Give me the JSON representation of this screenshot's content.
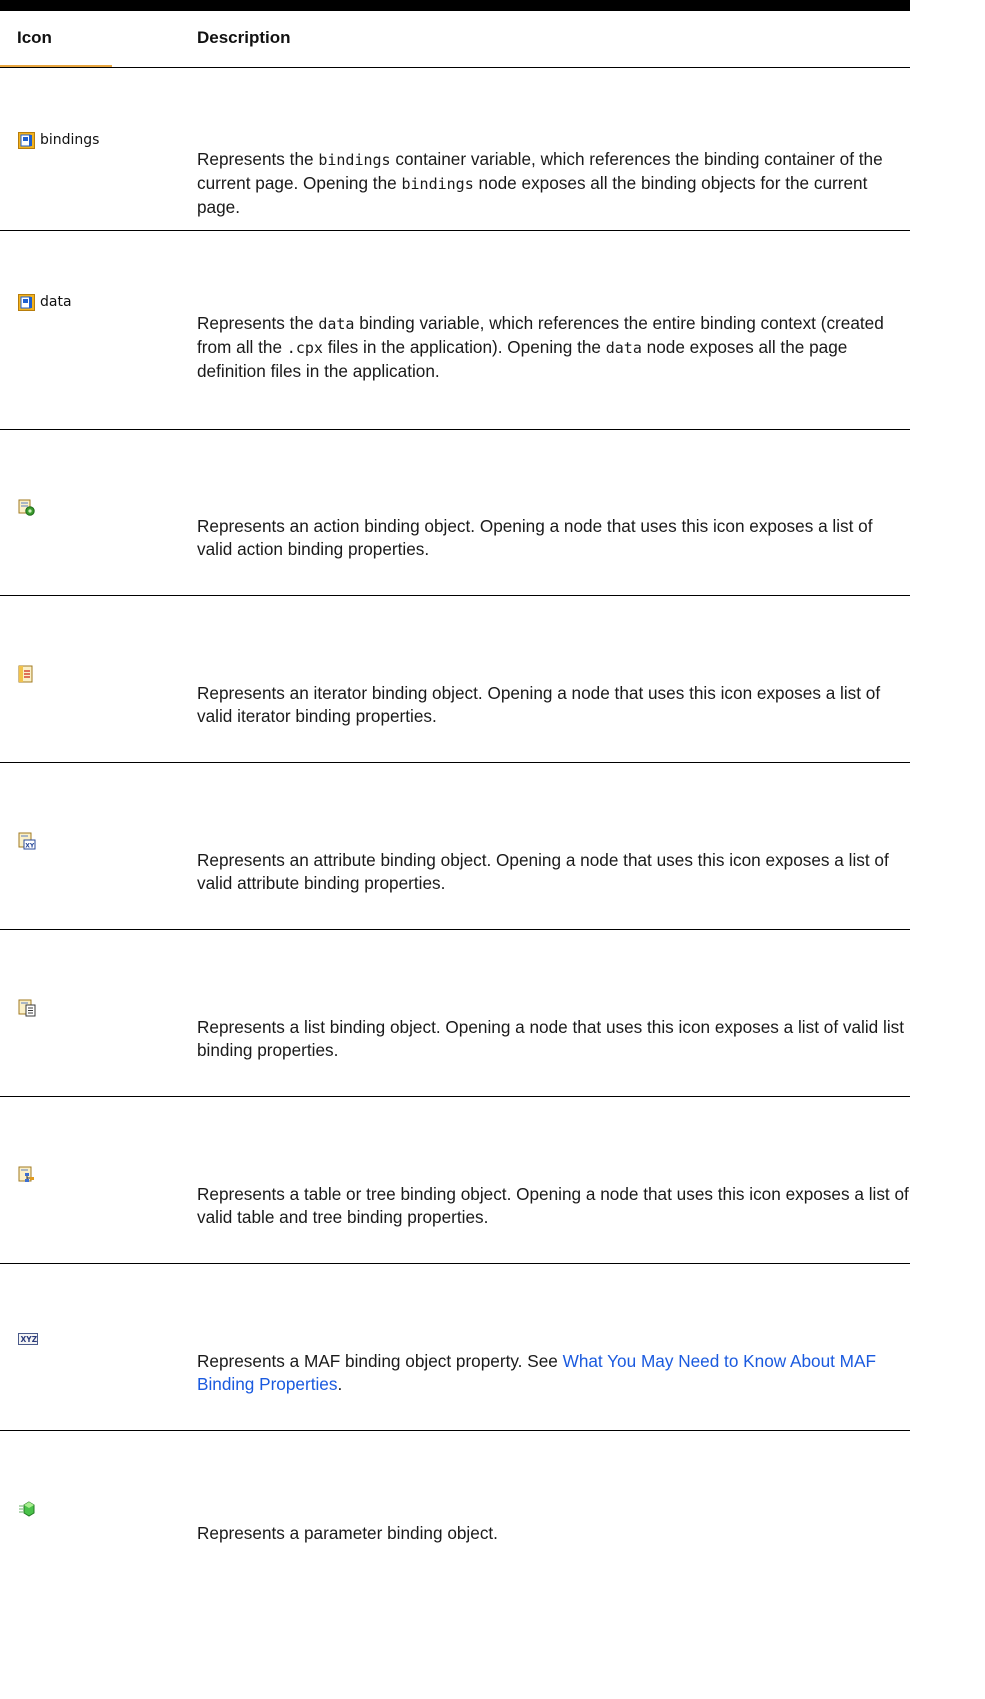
{
  "header": {
    "icon": "Icon",
    "description": "Description"
  },
  "rows": [
    {
      "icon": "folder-bindings-icon",
      "icon_label": "bindings",
      "desc": {
        "t1": "Represents the ",
        "c1": "bindings",
        "t2": " container variable, which references the binding container of the current page. Opening the ",
        "c2": "bindings",
        "t3": " node exposes all the binding objects for the current page."
      }
    },
    {
      "icon": "folder-data-icon",
      "icon_label": "data",
      "desc": {
        "t1": "Represents the ",
        "c1": "data",
        "t2": " binding variable, which references the entire binding context (created from all the ",
        "c2": ".cpx",
        "t3": " files in the application). Opening the ",
        "c3": "data",
        "t4": " node exposes all the page definition files in the application."
      }
    },
    {
      "icon": "action-binding-icon",
      "text": "Represents an action binding object. Opening a node that uses this icon exposes a list of valid action binding properties."
    },
    {
      "icon": "iterator-binding-icon",
      "text": "Represents an iterator binding object. Opening a node that uses this icon exposes a list of valid iterator binding properties."
    },
    {
      "icon": "attribute-binding-icon",
      "text": "Represents an attribute binding object. Opening a node that uses this icon exposes a list of valid attribute binding properties."
    },
    {
      "icon": "list-binding-icon",
      "text": "Represents a list binding object. Opening a node that uses this icon exposes a list of valid list binding properties."
    },
    {
      "icon": "table-tree-binding-icon",
      "text": "Represents a table or tree binding object. Opening a node that uses this icon exposes a list of valid table and tree binding properties."
    },
    {
      "icon": "binding-property-xyz-icon",
      "text": "Represents a MAF binding object property. See ",
      "link": "What You May Need to Know About MAF Binding Properties",
      "after": "."
    },
    {
      "icon": "parameter-binding-icon",
      "text": "Represents a parameter binding object."
    }
  ],
  "colors": {
    "link": "#1a5adf",
    "rule": "#000000",
    "folder": "#f2b21e",
    "folder_page": "#1d5fd0",
    "gear": "#3a9b2d",
    "cube": "#4ac24a"
  }
}
